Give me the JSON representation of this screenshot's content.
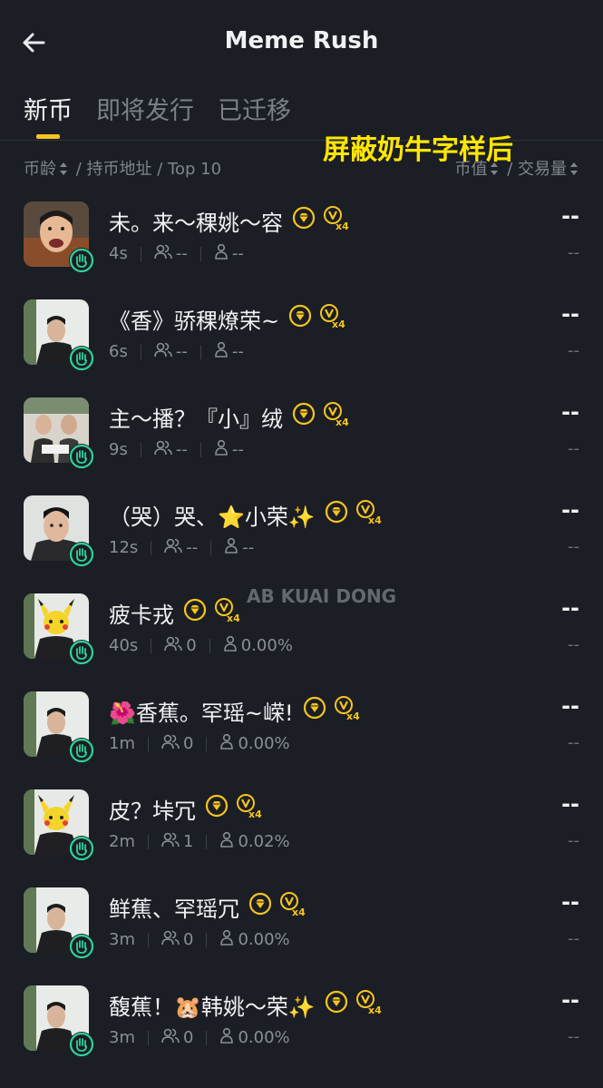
{
  "header": {
    "title": "Meme Rush"
  },
  "tabs": [
    {
      "label": "新币",
      "active": true
    },
    {
      "label": "即将发行",
      "active": false
    },
    {
      "label": "已迁移",
      "active": false
    }
  ],
  "watermark": "屏蔽奶牛字样后",
  "overlay_text": "AB KUAI DONG",
  "sortbar": {
    "left": {
      "age": "币龄",
      "rest": "/ 持币地址 / Top 10"
    },
    "right": {
      "mcap": "币值",
      "rest": "/ 交易量"
    }
  },
  "colors": {
    "accent": "#f7c51e",
    "badge": "#2fd39a",
    "background": "#1b1e24"
  },
  "icons": [
    "back-arrow-icon",
    "diamond-coin-icon",
    "v-x4-icon",
    "holders-icon",
    "top10-icon",
    "hand-badge-icon",
    "sort-icon"
  ],
  "tokens": [
    {
      "name": "未。来～稞姚～容",
      "age": "4s",
      "holders": "--",
      "top10": "--",
      "price": "--",
      "volume": "--",
      "avatar": "face"
    },
    {
      "name": "《香》骄稞燎荣~",
      "age": "6s",
      "holders": "--",
      "top10": "--",
      "price": "--",
      "volume": "--",
      "avatar": "man"
    },
    {
      "name": "主～播？『小』绒",
      "age": "9s",
      "holders": "--",
      "top10": "--",
      "price": "--",
      "volume": "--",
      "avatar": "group"
    },
    {
      "name": "（哭）哭、⭐小荣✨",
      "age": "12s",
      "holders": "--",
      "top10": "--",
      "price": "--",
      "volume": "--",
      "avatar": "man2"
    },
    {
      "name": "疲卡戎",
      "age": "40s",
      "holders": "0",
      "top10": "0.00%",
      "price": "--",
      "volume": "--",
      "avatar": "pika"
    },
    {
      "name": "🌺香蕉。罕瑶~嵘!",
      "age": "1m",
      "holders": "0",
      "top10": "0.00%",
      "price": "--",
      "volume": "--",
      "avatar": "man"
    },
    {
      "name": "皮？垰冗",
      "age": "2m",
      "holders": "1",
      "top10": "0.02%",
      "price": "--",
      "volume": "--",
      "avatar": "pika"
    },
    {
      "name": "鲜蕉、罕瑶冗",
      "age": "3m",
      "holders": "0",
      "top10": "0.00%",
      "price": "--",
      "volume": "--",
      "avatar": "man"
    },
    {
      "name": "馥蕉！🐹韩姚～荣✨",
      "age": "3m",
      "holders": "0",
      "top10": "0.00%",
      "price": "--",
      "volume": "--",
      "avatar": "man"
    }
  ]
}
